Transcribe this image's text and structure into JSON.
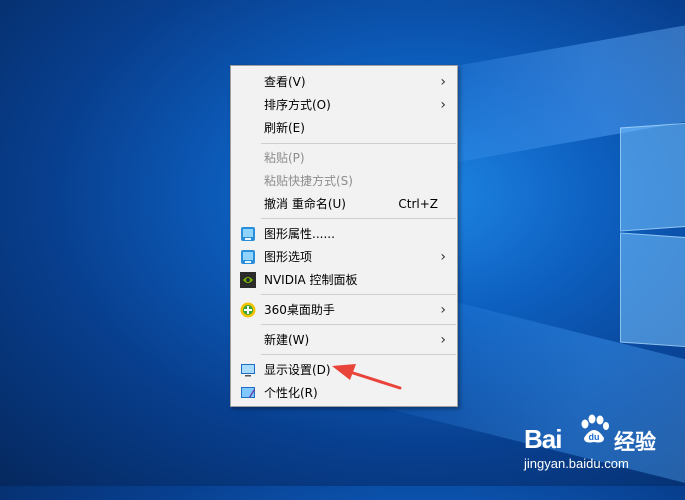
{
  "menu": {
    "items": [
      {
        "label": "查看(V)",
        "submenu": true
      },
      {
        "label": "排序方式(O)",
        "submenu": true
      },
      {
        "label": "刷新(E)"
      },
      {
        "label": "粘贴(P)",
        "disabled": true
      },
      {
        "label": "粘贴快捷方式(S)",
        "disabled": true
      },
      {
        "label": "撤消 重命名(U)",
        "shortcut": "Ctrl+Z"
      },
      {
        "label": "图形属性......",
        "icon": "intel-graphics-icon"
      },
      {
        "label": "图形选项",
        "icon": "intel-graphics-icon",
        "submenu": true
      },
      {
        "label": "NVIDIA 控制面板",
        "icon": "nvidia-icon"
      },
      {
        "label": "360桌面助手",
        "icon": "360-icon",
        "submenu": true
      },
      {
        "label": "新建(W)",
        "submenu": true
      },
      {
        "label": "显示设置(D)",
        "icon": "display-icon"
      },
      {
        "label": "个性化(R)",
        "icon": "personalize-icon"
      }
    ]
  },
  "watermark": {
    "logo": "Bai",
    "logo_suffix": "经验",
    "url": "jingyan.baidu.com"
  },
  "colors": {
    "menu_bg": "#f2f2f2",
    "disabled_text": "#8d8d8d",
    "arrow": "#e8443a",
    "desktop_blue": "#0d5fbf"
  }
}
